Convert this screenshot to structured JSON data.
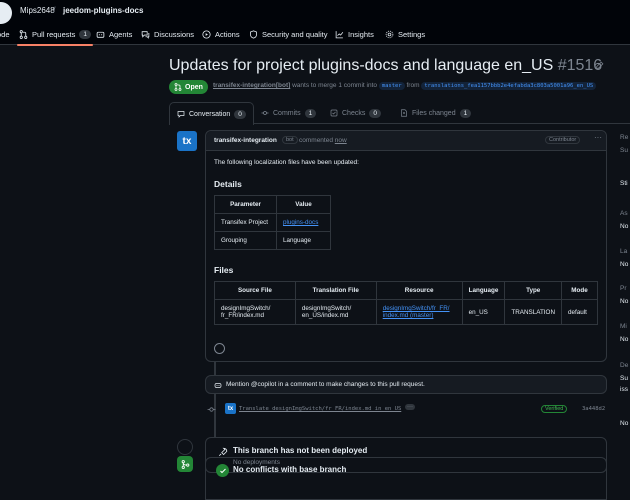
{
  "header": {
    "owner": "Mips2648",
    "separator": "/",
    "repo": "jeedom-plugins-docs",
    "nav": [
      {
        "label": "ode",
        "icon": "code-icon"
      },
      {
        "label": "Pull requests",
        "count": "1",
        "icon": "pull-request-icon"
      },
      {
        "label": "Agents",
        "icon": "agent-icon"
      },
      {
        "label": "Discussions",
        "icon": "discussion-icon"
      },
      {
        "label": "Actions",
        "icon": "play-icon"
      },
      {
        "label": "Security and quality",
        "icon": "shield-icon"
      },
      {
        "label": "Insights",
        "icon": "graph-icon"
      },
      {
        "label": "Settings",
        "icon": "gear-icon"
      }
    ]
  },
  "pr": {
    "title": "Updates for project plugins-docs and language en_US",
    "number": "#1516",
    "state": "Open",
    "author": "transifex-integration[bot]",
    "merge_text": "wants to merge 1 commit into",
    "base": "master",
    "from": "from",
    "head": "translations_fea1157bbb2e4efabda3c803a5001a96_en_US"
  },
  "tabs": [
    {
      "label": "Conversation",
      "count": "0"
    },
    {
      "label": "Commits",
      "count": "1"
    },
    {
      "label": "Checks",
      "count": "0"
    },
    {
      "label": "Files changed",
      "count": "1"
    }
  ],
  "comment": {
    "avatar_text": "tx",
    "author": "transifex-integration",
    "bot_badge": "bot",
    "commented": "commented",
    "when": "now",
    "role": "Contributor",
    "intro": "The following localization files have been updated:",
    "details_heading": "Details",
    "details_headers": [
      "Parameter",
      "Value"
    ],
    "details_rows": [
      [
        "Transifex Project",
        "plugins-docs"
      ],
      [
        "Grouping",
        "Language"
      ]
    ],
    "files_heading": "Files",
    "files_headers": [
      "Source File",
      "Translation File",
      "Resource",
      "Language",
      "Type",
      "Mode"
    ],
    "files_row": {
      "source_line1": "designImgSwitch/",
      "source_line2": "fr_FR/index.md",
      "translation_line1": "designImgSwitch/",
      "translation_line2": "en_US/index.md",
      "resource_line1": "designImgSwitch/fr_FR/",
      "resource_line2": "index.md (master)",
      "language": "en_US",
      "type": "TRANSLATION",
      "mode": "default"
    }
  },
  "mention": "Mention @copilot in a comment to make changes to this pull request.",
  "commit": {
    "avatar_text": "tx",
    "message": "Translate designImgSwitch/fr_FR/index.md in en_US",
    "ellipsis": "···",
    "verified": "Verified",
    "sha": "3a448d2"
  },
  "deploy": {
    "title": "This branch has not been deployed",
    "subtitle": "No deployments"
  },
  "merge": {
    "title": "No conflicts with base branch"
  },
  "sidebar": [
    {
      "label": "Re",
      "value": "Su"
    },
    {
      "label": "",
      "value": "Sti"
    },
    {
      "label": "As",
      "value": "No"
    },
    {
      "label": "La",
      "value": "No"
    },
    {
      "label": "Pr",
      "value": "No"
    },
    {
      "label": "Mi",
      "value": "No"
    },
    {
      "label": "De",
      "value": "Su"
    },
    {
      "label": "iss",
      "value": ""
    },
    {
      "label": "",
      "value": "No"
    }
  ]
}
